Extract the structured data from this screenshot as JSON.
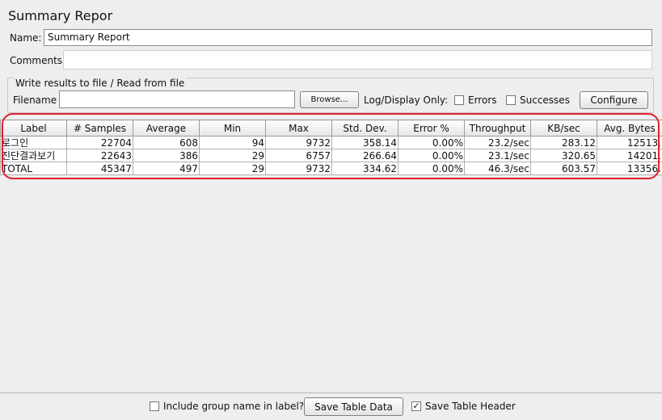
{
  "title": "Summary Repor",
  "name_field": {
    "label": "Name:",
    "value": "Summary Report"
  },
  "comments_field": {
    "label": "Comments:",
    "value": ""
  },
  "file_section": {
    "legend": "Write results to file / Read from file",
    "filename_label": "Filename",
    "filename_value": "",
    "browse_label": "Browse...",
    "log_display_label": "Log/Display Only:",
    "errors_label": "Errors",
    "successes_label": "Successes",
    "configure_label": "Configure"
  },
  "table": {
    "columns": [
      "Label",
      "# Samples",
      "Average",
      "Min",
      "Max",
      "Std. Dev.",
      "Error %",
      "Throughput",
      "KB/sec",
      "Avg. Bytes"
    ],
    "rows": [
      [
        "로그인",
        "22704",
        "608",
        "94",
        "9732",
        "358.14",
        "0.00%",
        "23.2/sec",
        "283.12",
        "12513."
      ],
      [
        "진단결과보기",
        "22643",
        "386",
        "29",
        "6757",
        "266.64",
        "0.00%",
        "23.1/sec",
        "320.65",
        "14201."
      ],
      [
        "TOTAL",
        "45347",
        "497",
        "29",
        "9732",
        "334.62",
        "0.00%",
        "46.3/sec",
        "603.57",
        "13356."
      ]
    ]
  },
  "footer": {
    "include_group_label": "Include group name in label?",
    "include_group_checked": false,
    "save_table_data_label": "Save Table Data",
    "save_table_header_label": "Save Table Header",
    "save_table_header_checked": true
  },
  "colors": {
    "highlight": "#e0202c"
  }
}
